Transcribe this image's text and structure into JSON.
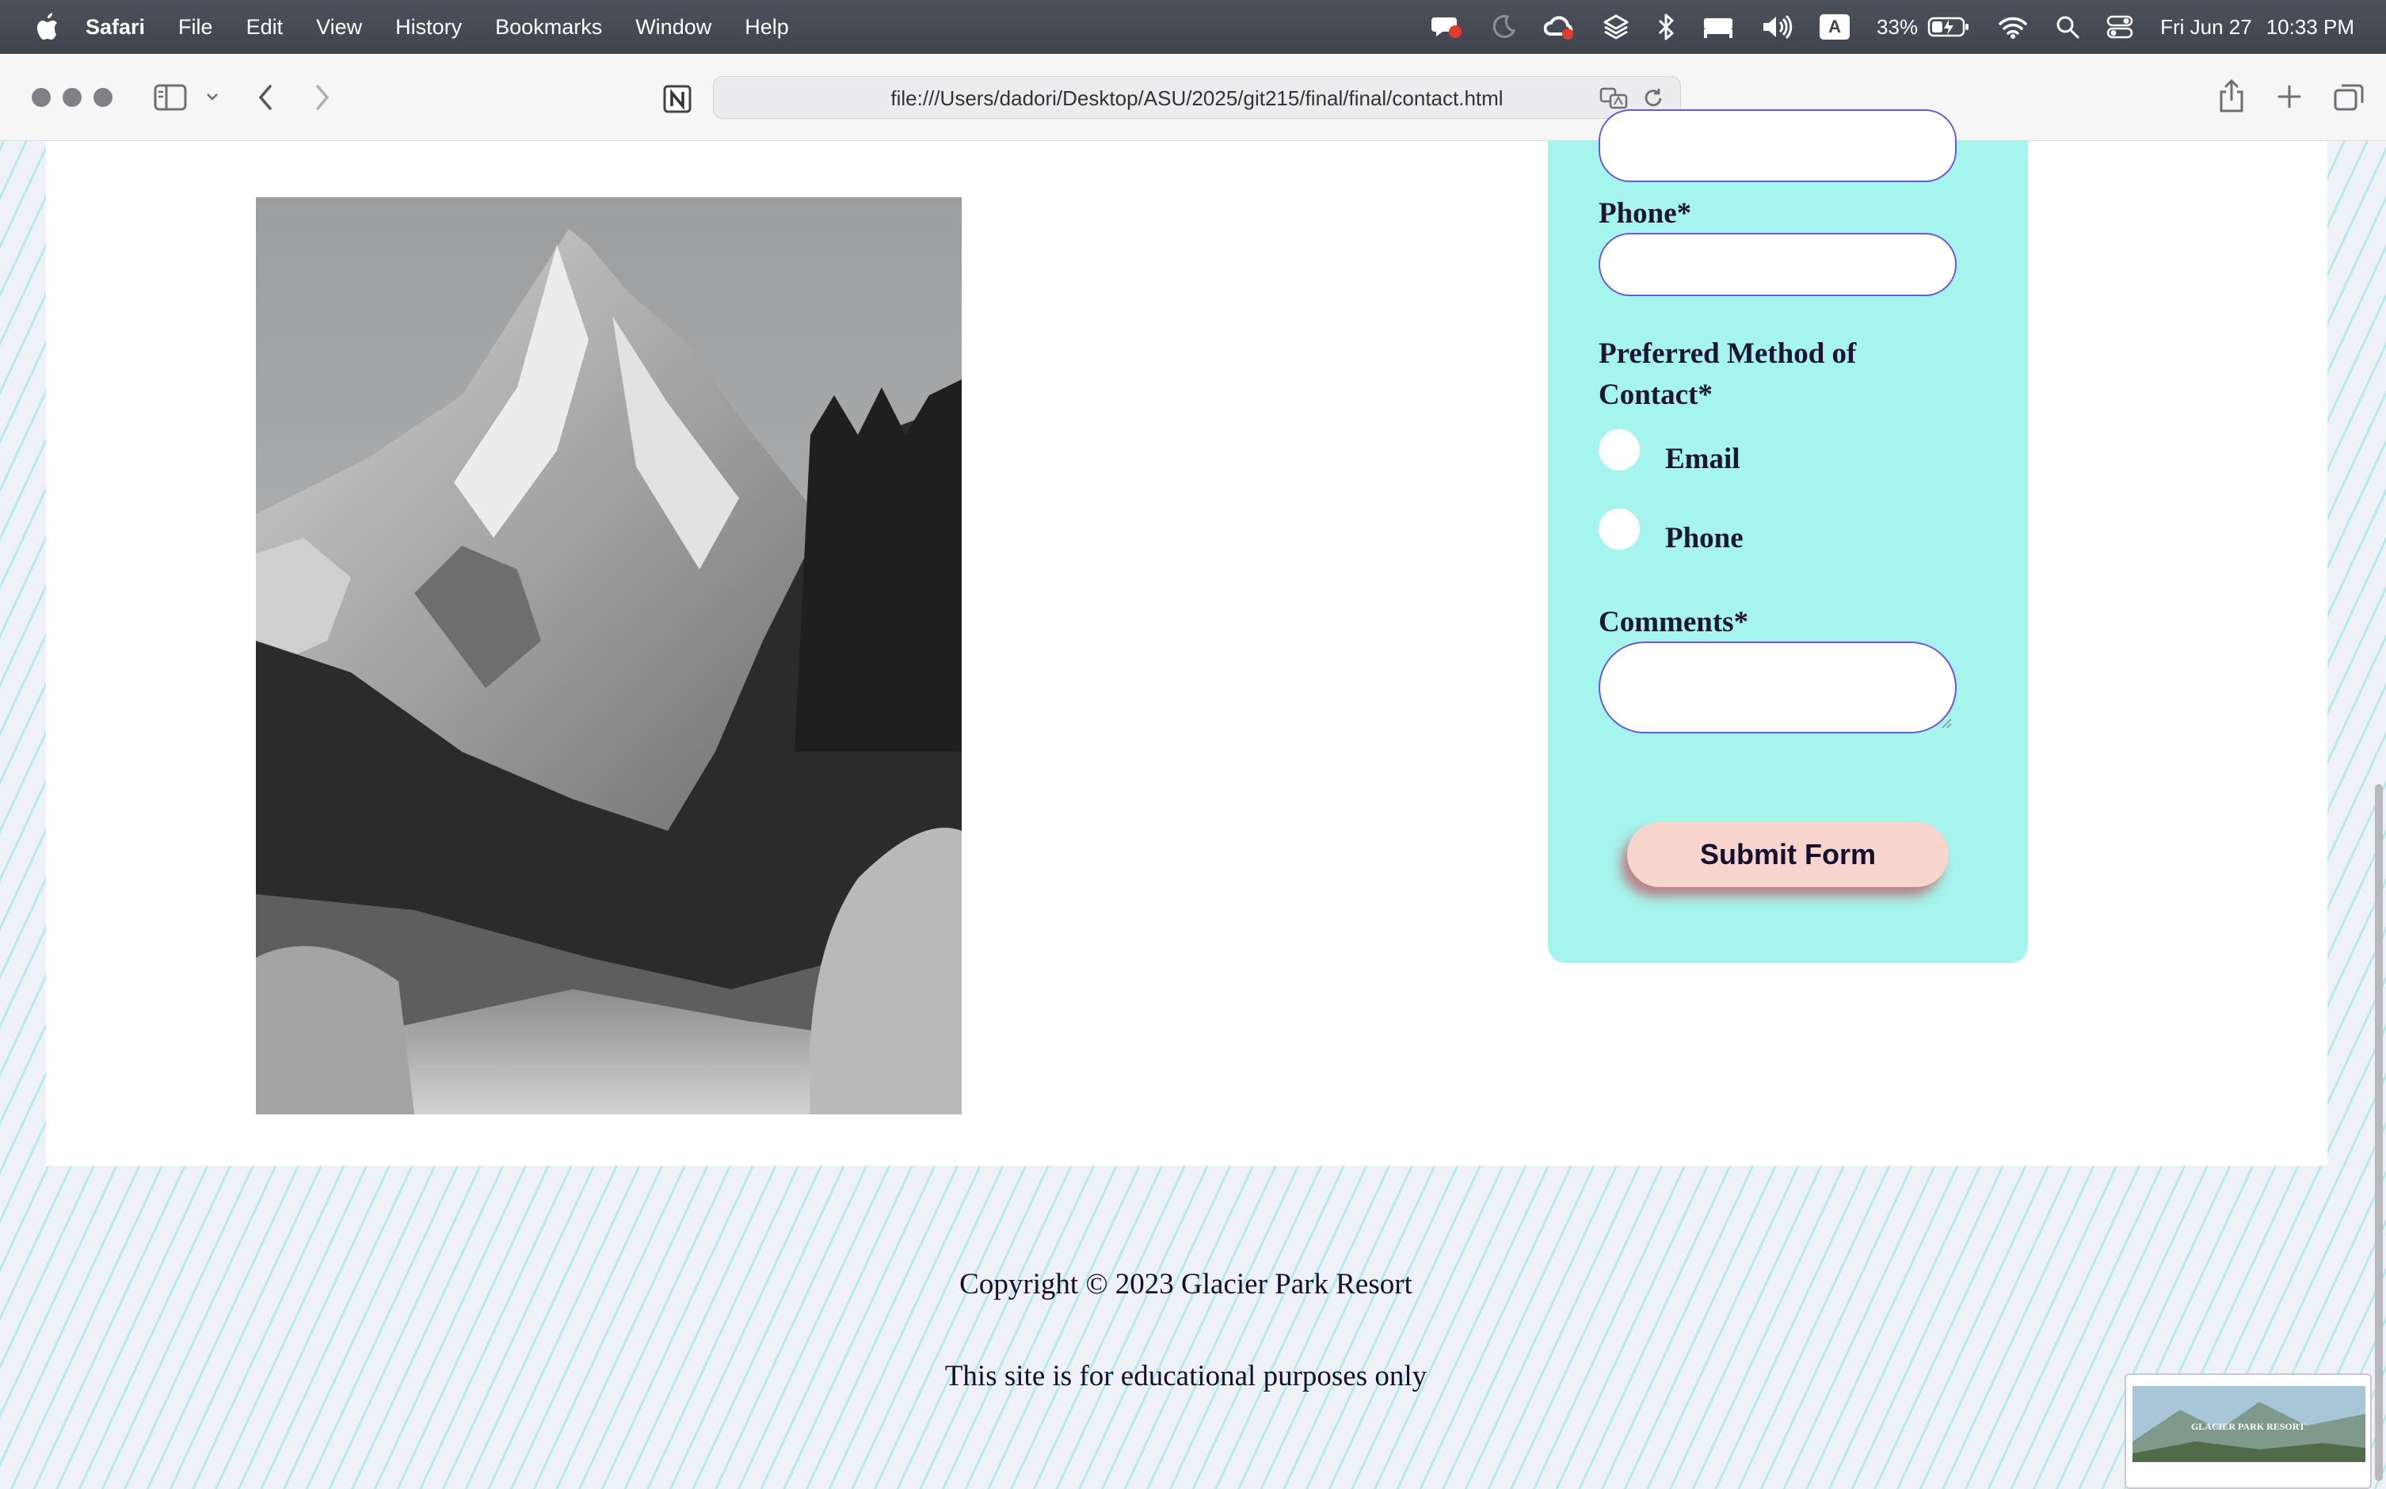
{
  "menubar": {
    "app_name": "Safari",
    "menus": [
      "File",
      "Edit",
      "View",
      "History",
      "Bookmarks",
      "Window",
      "Help"
    ],
    "input_source": "A",
    "battery_percent": "33%",
    "date": "Fri Jun 27",
    "time": "10:33 PM",
    "status_icons": [
      "screen-record-icon",
      "focus-moon-icon",
      "creative-cloud-icon",
      "layers-icon",
      "bluetooth-icon",
      "bed-icon",
      "volume-icon",
      "input-source-icon",
      "battery-icon",
      "wifi-icon",
      "spotlight-search-icon",
      "control-center-icon"
    ]
  },
  "browser": {
    "url": "file:///Users/dadori/Desktop/ASU/2025/git215/final/final/contact.html",
    "icons": [
      "sidebar-icon",
      "back-icon",
      "forward-icon",
      "notion-icon",
      "translate-icon",
      "reload-icon",
      "share-icon",
      "new-tab-icon",
      "tab-overview-icon"
    ]
  },
  "form": {
    "phone_label": "Phone*",
    "contact_method_label": "Preferred Method of Contact*",
    "options": [
      {
        "label": "Email",
        "selected": false
      },
      {
        "label": "Phone",
        "selected": false
      }
    ],
    "comments_label": "Comments*",
    "submit_label": "Submit Form"
  },
  "footer": {
    "copyright": "Copyright © 2023 Glacier Park Resort",
    "disclaimer": "This site is for educational purposes only"
  },
  "thumbnail": {
    "title": "GLACIER PARK RESORT"
  },
  "colors": {
    "form_background": "#a6f4ee",
    "input_border": "#6a55e0",
    "submit_background": "#f7d4cc",
    "text_dark": "#150f2e"
  }
}
